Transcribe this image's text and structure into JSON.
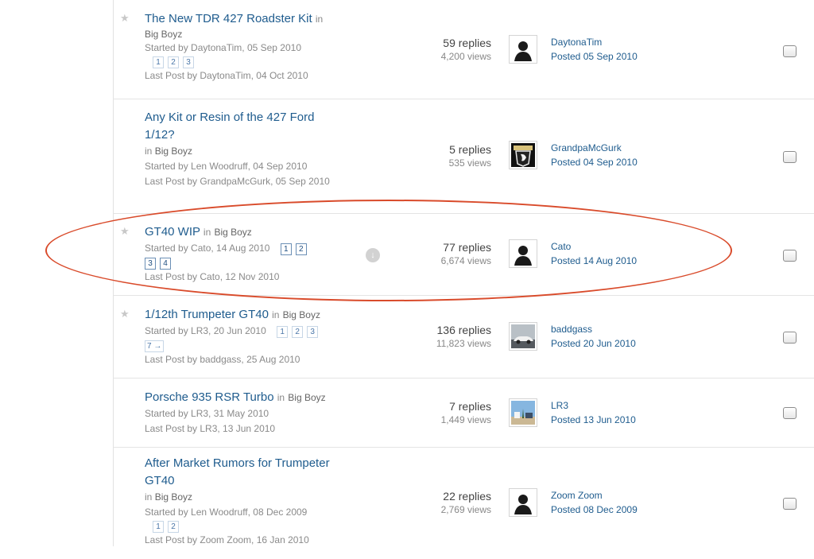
{
  "topics": [
    {
      "title": "The New TDR 427 Roadster Kit",
      "in_label": "in",
      "forum": "Big Boyz",
      "started": "Started by DaytonaTim, 05 Sep 2010",
      "pages": [
        "1",
        "2",
        "3"
      ],
      "last_post": "Last Post by DaytonaTim, 04 Oct 2010",
      "replies": "59 replies",
      "views": "4,200 views",
      "lp_user": "DaytonaTim",
      "lp_date": "Posted 05 Sep 2010",
      "avatar": "silhouette"
    },
    {
      "title": "Any Kit or Resin of the 427 Ford 1/12?",
      "in_label": "in",
      "forum": "Big Boyz",
      "started": "Started by Len Woodruff, 04 Sep 2010",
      "pages": [],
      "last_post": "Last Post by GrandpaMcGurk, 05 Sep 2010",
      "replies": "5 replies",
      "views": "535 views",
      "lp_user": "GrandpaMcGurk",
      "lp_date": "Posted 04 Sep 2010",
      "avatar": "eagle-patch"
    },
    {
      "title": "GT40 WIP",
      "in_label": "in",
      "forum": "Big Boyz",
      "started": "Started by Cato, 14 Aug 2010",
      "pages": [
        "1",
        "2",
        "3",
        "4"
      ],
      "last_post": "Last Post by Cato, 12 Nov 2010",
      "replies": "77 replies",
      "views": "6,674 views",
      "lp_user": "Cato",
      "lp_date": "Posted 14 Aug 2010",
      "avatar": "silhouette"
    },
    {
      "title": "1/12th Trumpeter GT40",
      "in_label": "in",
      "forum": "Big Boyz",
      "started": "Started by LR3, 20 Jun 2010",
      "pages": [
        "1",
        "2",
        "3",
        "7 →"
      ],
      "last_post": "Last Post by baddgass, 25 Aug 2010",
      "replies": "136 replies",
      "views": "11,823 views",
      "lp_user": "baddgass",
      "lp_date": "Posted 20 Jun 2010",
      "avatar": "car-photo"
    },
    {
      "title": "Porsche 935 RSR Turbo",
      "in_label": "in",
      "forum": "Big Boyz",
      "started": "Started by LR3, 31 May 2010",
      "pages": [],
      "last_post": "Last Post by LR3, 13 Jun 2010",
      "replies": "7 replies",
      "views": "1,449 views",
      "lp_user": "LR3",
      "lp_date": "Posted 13 Jun 2010",
      "avatar": "landscape-photo"
    },
    {
      "title": "After Market Rumors for Trumpeter GT40",
      "in_label": "in",
      "forum": "Big Boyz",
      "started": "Started by Len Woodruff, 08 Dec 2009",
      "pages": [
        "1",
        "2"
      ],
      "last_post": "Last Post by Zoom Zoom, 16 Jan 2010",
      "replies": "22 replies",
      "views": "2,769 views",
      "lp_user": "Zoom Zoom",
      "lp_date": "Posted 08 Dec 2009",
      "avatar": "silhouette"
    }
  ],
  "annotation_color": "#d94b2b",
  "link_color": "#1f5c8e"
}
